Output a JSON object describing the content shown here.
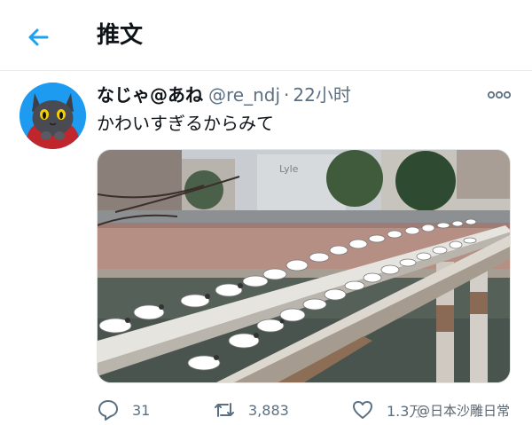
{
  "header": {
    "title": "推文"
  },
  "tweet": {
    "display_name": "なじゃ@あね",
    "handle": "@re_ndj",
    "separator": "·",
    "time": "22小时",
    "text": "かわいすぎるからみて",
    "image_sign": "Lyle"
  },
  "actions": {
    "reply_count": "31",
    "retweet_count": "3,883",
    "like_count": "1.3万"
  },
  "watermark": "@日本沙雕日常",
  "colors": {
    "accent": "#1da1f2",
    "secondary_text": "#5b7083",
    "divider": "#e6ecf0"
  }
}
